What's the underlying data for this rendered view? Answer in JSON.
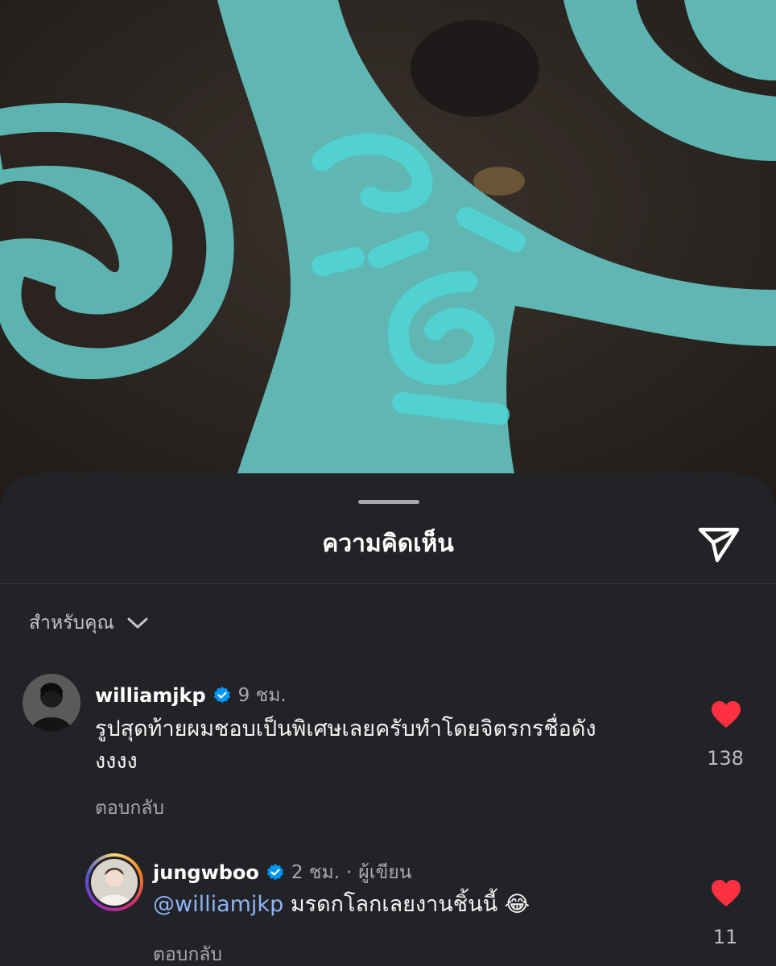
{
  "sheet": {
    "title": "ความคิดเห็น",
    "filter_label": "สำหรับคุณ"
  },
  "comments": [
    {
      "username": "williamjkp",
      "time": "9 ชม.",
      "text_line1": "รูปสุดท้ายผมชอบเป็นพิเศษเลยครับทำโดยจิตรกรชื่อดัง",
      "text_line2": "งงงง",
      "reply_label": "ตอบกลับ",
      "likes": "138"
    },
    {
      "username": "jungwboo",
      "time": "2 ชม.",
      "author_label": "ผู้เขียน",
      "mention": "@williamjkp",
      "text": "มรดกโลกเลยงานชิ้นนี้",
      "emoji": "😂",
      "reply_label": "ตอบกลับ",
      "likes": "11"
    }
  ],
  "colors": {
    "heart": "#ff3040",
    "verified": "#0095f6",
    "mention": "#8fb3f5",
    "sheet_bg": "#222327"
  },
  "icons": [
    "send-icon",
    "chevron-down-icon",
    "verified-badge-icon",
    "heart-icon"
  ]
}
